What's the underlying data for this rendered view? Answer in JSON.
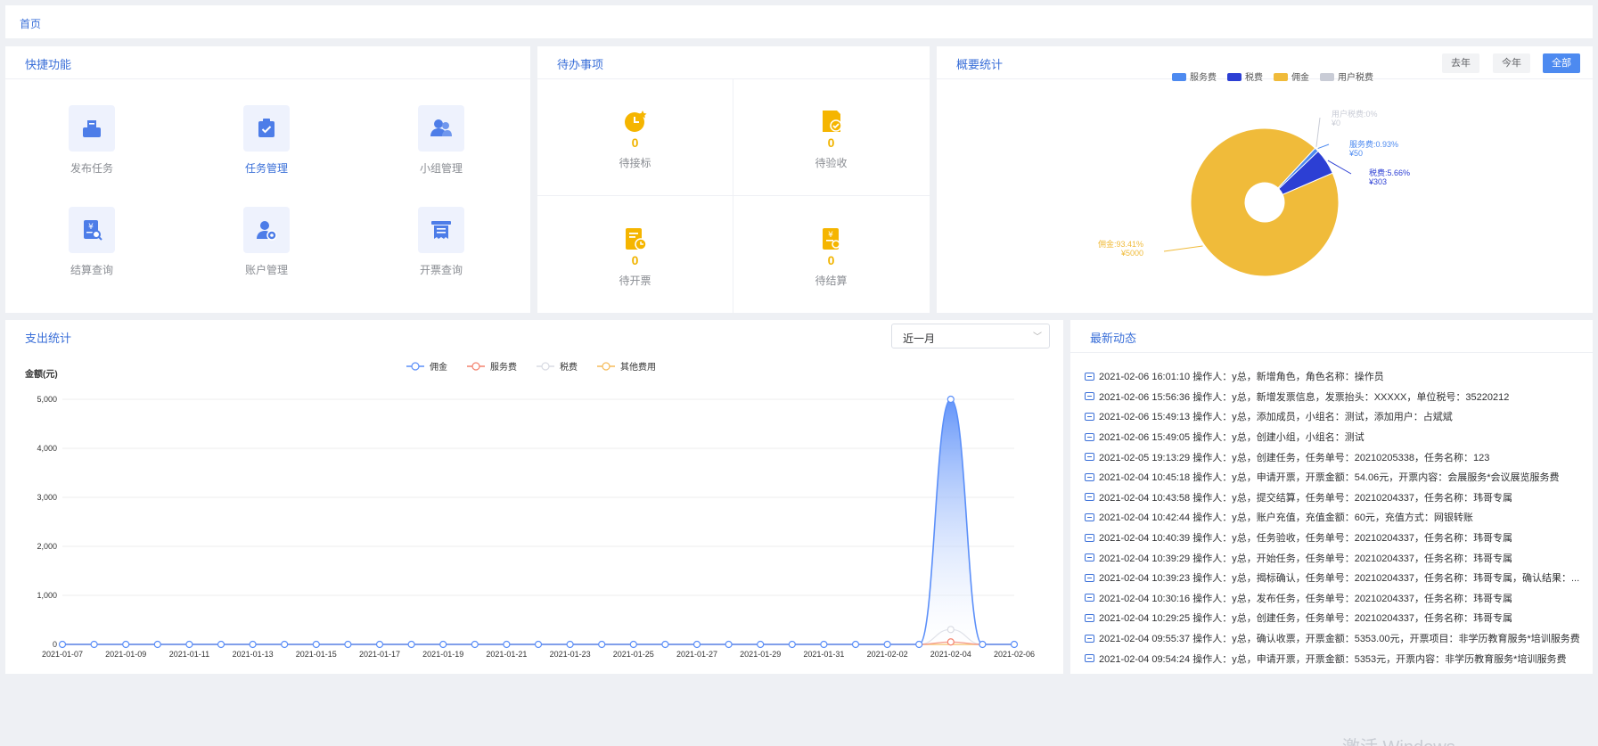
{
  "breadcrumb": {
    "home": "首页"
  },
  "quick": {
    "title": "快捷功能",
    "items": [
      {
        "label": "发布任务",
        "icon": "publish-task-icon"
      },
      {
        "label": "任务管理",
        "icon": "task-manage-icon"
      },
      {
        "label": "小组管理",
        "icon": "group-manage-icon"
      },
      {
        "label": "结算查询",
        "icon": "settlement-query-icon"
      },
      {
        "label": "账户管理",
        "icon": "account-manage-icon"
      },
      {
        "label": "开票查询",
        "icon": "invoice-query-icon"
      }
    ],
    "accent": "#3a6fd8"
  },
  "todo": {
    "title": "待办事项",
    "items": [
      {
        "count": "0",
        "label": "待接标",
        "icon": "pending-bid-icon"
      },
      {
        "count": "0",
        "label": "待验收",
        "icon": "pending-accept-icon"
      },
      {
        "count": "0",
        "label": "待开票",
        "icon": "pending-invoice-icon"
      },
      {
        "count": "0",
        "label": "待结算",
        "icon": "pending-settle-icon"
      }
    ],
    "color": "#f1b400"
  },
  "overview": {
    "title": "概要统计",
    "buttons": {
      "last_year": "去年",
      "this_year": "今年",
      "all": "全部"
    },
    "legend": [
      "服务费",
      "税费",
      "佣金",
      "用户税费"
    ],
    "slices": [
      {
        "name": "服务费",
        "label": "服务费:0.93%",
        "amount": "¥50",
        "value": 50,
        "percent": 0.93,
        "color": "#4d8af0"
      },
      {
        "name": "税费",
        "label": "税费:5.66%",
        "amount": "¥303",
        "value": 303,
        "percent": 5.66,
        "color": "#2c3fd4"
      },
      {
        "name": "佣金",
        "label": "佣金:93.41%",
        "amount": "¥5000",
        "value": 5000,
        "percent": 93.41,
        "color": "#f0bb3a"
      },
      {
        "name": "用户税费",
        "label": "用户税费:0%",
        "amount": "¥0",
        "value": 0,
        "percent": 0,
        "color": "#c9ccd6"
      }
    ]
  },
  "expense": {
    "title": "支出统计",
    "period": "近一月",
    "y_axis_label": "金额(元)"
  },
  "chart_data": {
    "type": "line",
    "ylabel": "金额(元)",
    "ylim": [
      0,
      5000
    ],
    "yticks": [
      "0",
      "1,000",
      "2,000",
      "3,000",
      "4,000",
      "5,000"
    ],
    "x": [
      "2021-01-07",
      "2021-01-08",
      "2021-01-09",
      "2021-01-10",
      "2021-01-11",
      "2021-01-12",
      "2021-01-13",
      "2021-01-14",
      "2021-01-15",
      "2021-01-16",
      "2021-01-17",
      "2021-01-18",
      "2021-01-19",
      "2021-01-20",
      "2021-01-21",
      "2021-01-22",
      "2021-01-23",
      "2021-01-24",
      "2021-01-25",
      "2021-01-26",
      "2021-01-27",
      "2021-01-28",
      "2021-01-29",
      "2021-01-30",
      "2021-01-31",
      "2021-02-01",
      "2021-02-02",
      "2021-02-03",
      "2021-02-04",
      "2021-02-05",
      "2021-02-06"
    ],
    "series": [
      {
        "name": "佣金",
        "color": "#5b8ff9",
        "values": [
          0,
          0,
          0,
          0,
          0,
          0,
          0,
          0,
          0,
          0,
          0,
          0,
          0,
          0,
          0,
          0,
          0,
          0,
          0,
          0,
          0,
          0,
          0,
          0,
          0,
          0,
          0,
          0,
          5000,
          0,
          0
        ]
      },
      {
        "name": "服务费",
        "color": "#f3826e",
        "values": [
          0,
          0,
          0,
          0,
          0,
          0,
          0,
          0,
          0,
          0,
          0,
          0,
          0,
          0,
          0,
          0,
          0,
          0,
          0,
          0,
          0,
          0,
          0,
          0,
          0,
          0,
          0,
          0,
          50,
          0,
          0
        ]
      },
      {
        "name": "税费",
        "color": "#d9dbe3",
        "values": [
          0,
          0,
          0,
          0,
          0,
          0,
          0,
          0,
          0,
          0,
          0,
          0,
          0,
          0,
          0,
          0,
          0,
          0,
          0,
          0,
          0,
          0,
          0,
          0,
          0,
          0,
          0,
          0,
          303,
          0,
          0
        ]
      },
      {
        "name": "其他费用",
        "color": "#f5bb5a",
        "values": [
          0,
          0,
          0,
          0,
          0,
          0,
          0,
          0,
          0,
          0,
          0,
          0,
          0,
          0,
          0,
          0,
          0,
          0,
          0,
          0,
          0,
          0,
          0,
          0,
          0,
          0,
          0,
          0,
          0,
          0,
          0
        ]
      }
    ]
  },
  "news": {
    "title": "最新动态",
    "items": [
      "2021-02-06 16:01:10 操作人：y总，新增角色，角色名称：操作员",
      "2021-02-06 15:56:36 操作人：y总，新增发票信息，发票抬头：XXXXX，单位税号：35220212",
      "2021-02-06 15:49:13 操作人：y总，添加成员，小组名：测试，添加用户：占斌斌",
      "2021-02-06 15:49:05 操作人：y总，创建小组，小组名：测试",
      "2021-02-05 19:13:29 操作人：y总，创建任务，任务单号：20210205338，任务名称：123",
      "2021-02-04 10:45:18 操作人：y总，申请开票，开票金额：54.06元，开票内容：会展服务*会议展览服务费",
      "2021-02-04 10:43:58 操作人：y总，提交结算，任务单号：20210204337，任务名称：玮哥专属",
      "2021-02-04 10:42:44 操作人：y总，账户充值，充值金额：60元，充值方式：网银转账",
      "2021-02-04 10:40:39 操作人：y总，任务验收，任务单号：20210204337，任务名称：玮哥专属",
      "2021-02-04 10:39:29 操作人：y总，开始任务，任务单号：20210204337，任务名称：玮哥专属",
      "2021-02-04 10:39:23 操作人：y总，揭标确认，任务单号：20210204337，任务名称：玮哥专属，确认结果：...",
      "2021-02-04 10:30:16 操作人：y总，发布任务，任务单号：20210204337，任务名称：玮哥专属",
      "2021-02-04 10:29:25 操作人：y总，创建任务，任务单号：20210204337，任务名称：玮哥专属",
      "2021-02-04 09:55:37 操作人：y总，确认收票，开票金额：5353.00元，开票项目：非学历教育服务*培训服务费",
      "2021-02-04 09:54:24 操作人：y总，申请开票，开票金额：5353元，开票内容：非学历教育服务*培训服务费"
    ]
  },
  "watermark": "激活 Windows"
}
